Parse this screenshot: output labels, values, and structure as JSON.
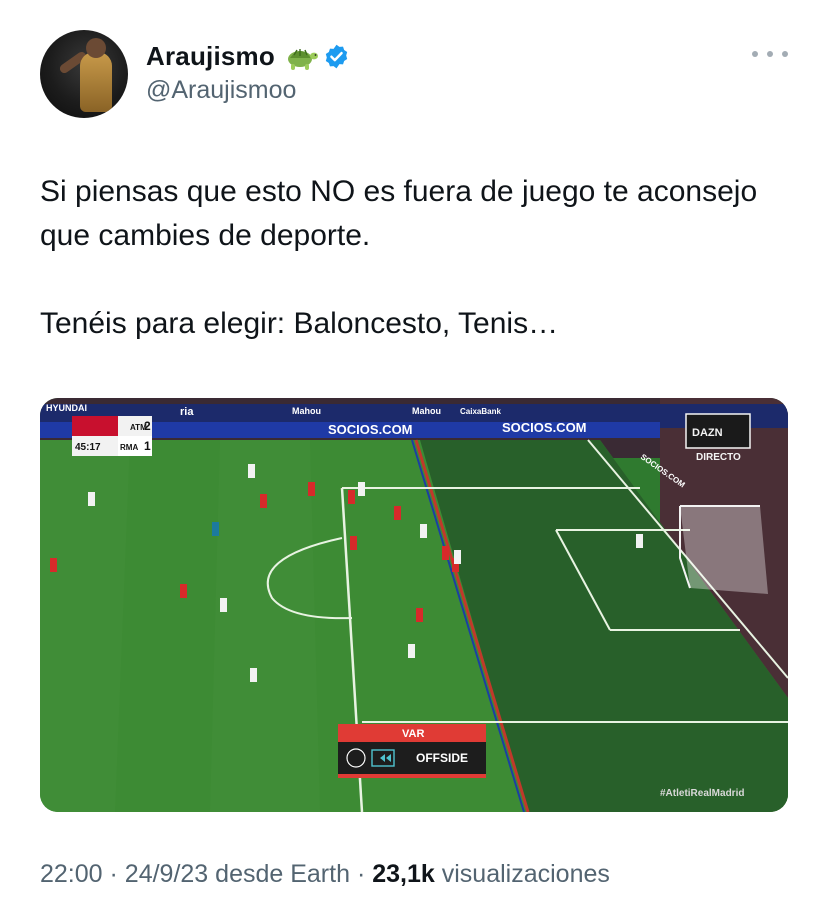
{
  "author": {
    "display_name": "Araujismo",
    "handle": "@Araujismoo",
    "emoji": "turtle-icon",
    "verified_icon": "verified-badge-icon"
  },
  "tweet": {
    "line1": "Si piensas que esto NO es fuera de juego te aconsejo que cambies de deporte.",
    "line2": "Tenéis para elegir: Baloncesto, Tenis…"
  },
  "media": {
    "scoreboard": {
      "team1": "ATM",
      "score1": "2",
      "team2": "RMA",
      "score2": "1",
      "clock": "45:17"
    },
    "broadcaster": "DAZN",
    "live_label": "DIRECTO",
    "var_title": "VAR",
    "var_status": "OFFSIDE",
    "hashtag": "#AtletiRealMadrid",
    "ads": [
      "HYUNDAI",
      "ria",
      "Mahou",
      "Mahou",
      "CaixaBank",
      "SOCIOS.COM",
      "SOCIOS.COM",
      "SOCIOS.COM"
    ],
    "colors": {
      "pitch": "#2f7a2f",
      "var_red": "#e03b35",
      "atm_red": "#c8102e",
      "dazn": "#f4f4f4"
    }
  },
  "footer": {
    "time": "22:00",
    "sep1": "·",
    "date": "24/9/23",
    "source": "desde Earth",
    "sep2": "·",
    "views_count": "23,1k",
    "views_label": "visualizaciones"
  }
}
